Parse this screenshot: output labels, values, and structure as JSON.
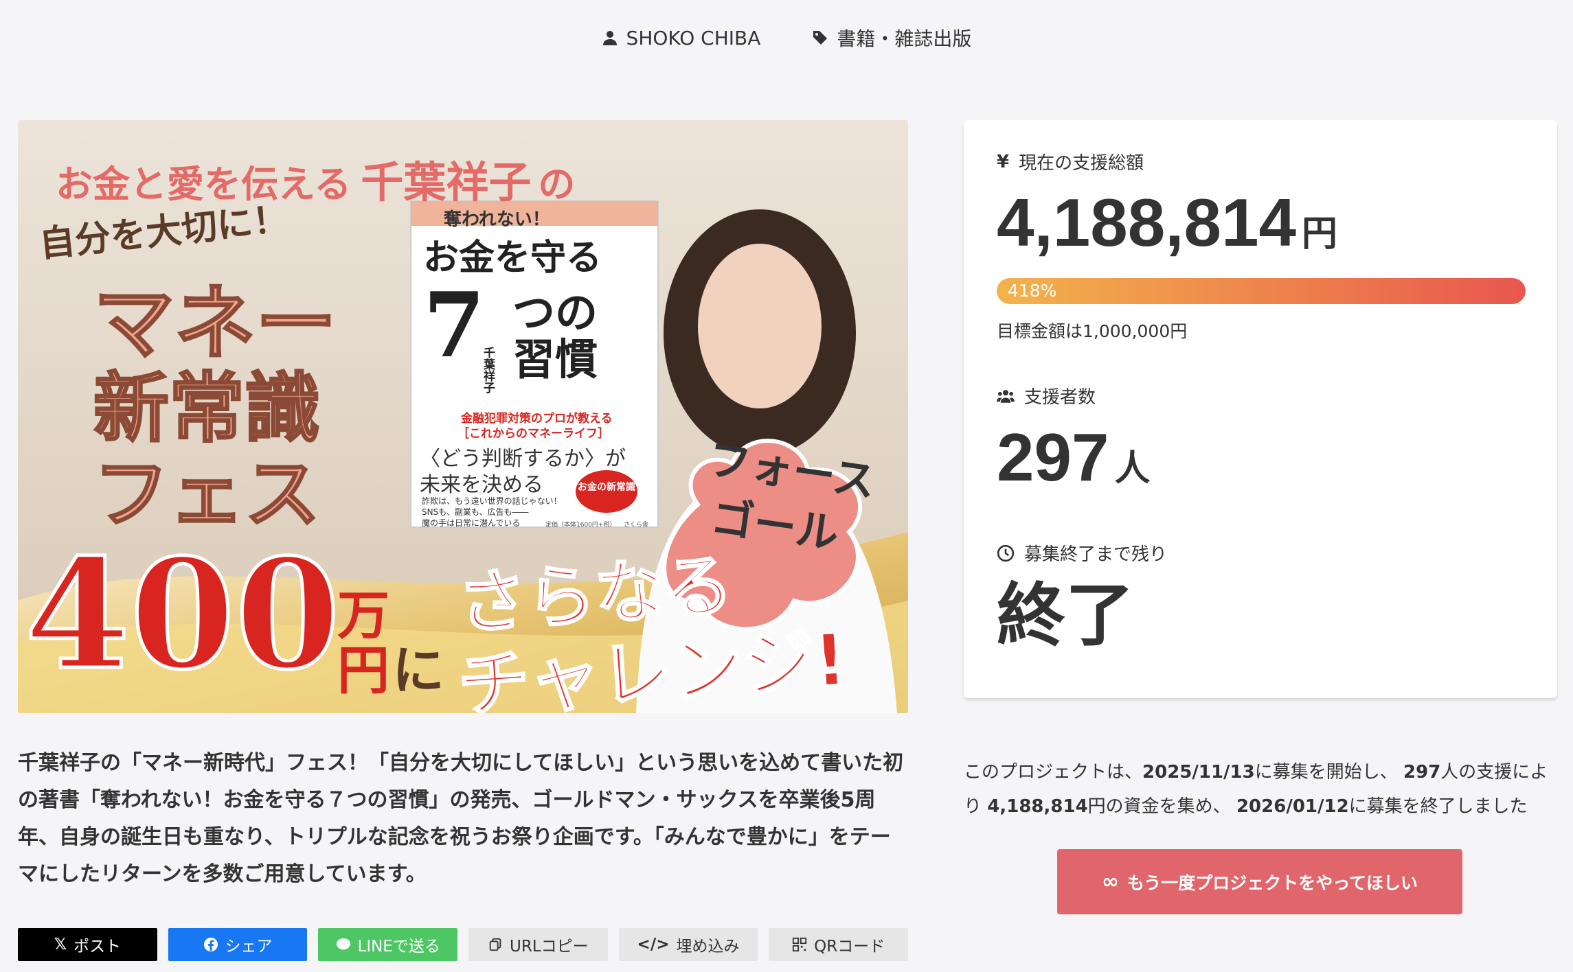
{
  "header": {
    "owner": "SHOKO CHIBA",
    "category": "書籍・雑誌出版"
  },
  "hero": {
    "line1a": "お金と愛を伝える",
    "line1b": "千葉祥子",
    "line1c": "の",
    "line2": "自分を大切に！",
    "line3": "マネー",
    "line4": "新常識",
    "line5": "フェス",
    "amount": "400",
    "amount_unit1": "万",
    "amount_unit2": "円",
    "amount_ni": "に",
    "sarani": "さらなる",
    "challenge": "チャレンジ!",
    "bubble1": "フォース",
    "bubble2": "ゴール",
    "book": {
      "subtitle": "奪われない！",
      "title": "お金を守る",
      "seven": "7",
      "habits1": "つの",
      "habits2": "習慣",
      "author": "千葉祥子",
      "tagline1": "金融犯罪対策のプロが教える",
      "tagline2": "［これからのマネーライフ］",
      "judge": "〈どう判断するか〉が",
      "future": "未来を決める",
      "small1": "詐欺は、もう遠い世界の話じゃない！",
      "small2": "SNSも、副業も、広告も――",
      "small3": "魔の手は日常に潜んでいる",
      "badge": "お金の新常識",
      "price": "定価（本体1600円+税）",
      "publisher": "さくら舎"
    }
  },
  "card": {
    "total_label": "現在の支援総額",
    "total_amount": "4,188,814",
    "total_unit": "円",
    "progress_percent": 418,
    "progress_label": "418%",
    "goal_text": "目標金額は1,000,000円",
    "backers_label": "支援者数",
    "backers_count": "297",
    "backers_unit": "人",
    "remaining_label": "募集終了まで残り",
    "remaining_value": "終了"
  },
  "summary": {
    "t1": "このプロジェクトは、",
    "start": "2025/11/13",
    "t2": "に募集を開始し、",
    "backers": "297",
    "t3": "人の支援により",
    "amount": "4,188,814",
    "t4": "円の資金を集め、",
    "end": "2026/01/12",
    "t5": "に募集を終了しました"
  },
  "again_button": "もう一度プロジェクトをやってほしい",
  "description": "千葉祥子の「マネー新時代」フェス！「自分を大切にしてほしい」という思いを込めて書いた初の著書「奪われない！お金を守る７つの習慣」の発売、ゴールドマン・サックスを卒業後5周年、自身の誕生日も重なり、トリプルな記念を祝うお祭り企画です。「みんなで豊かに」をテーマにしたリターンを多数ご用意しています。",
  "share": {
    "x": "ポスト",
    "facebook": "シェア",
    "line": "LINEで送る",
    "url": "URLコピー",
    "embed": "埋め込み",
    "qr": "QRコード"
  },
  "colors": {
    "accent": "#e0666b",
    "progress_start": "#f2b34c",
    "progress_end": "#e8574f",
    "facebook": "#1877f2",
    "line": "#4cc764"
  }
}
